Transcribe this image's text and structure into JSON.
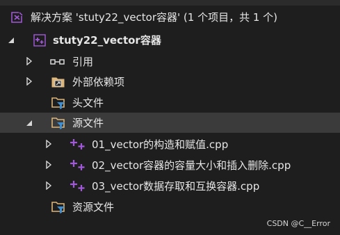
{
  "top_text": "",
  "tree": {
    "solution": {
      "label": "解决方案 'stuty22_vector容器' (1 个项目，共 1 个)",
      "icon": "visual-studio-solution-icon"
    },
    "project": {
      "label": "stuty22_vector容器",
      "icon": "cpp-project-icon"
    },
    "references": {
      "label": "引用",
      "icon": "references-icon"
    },
    "external_deps": {
      "label": "外部依赖项",
      "icon": "external-dependencies-icon"
    },
    "header_files": {
      "label": "头文件",
      "icon": "filter-folder-icon"
    },
    "source_files": {
      "label": "源文件",
      "icon": "filter-folder-icon"
    },
    "files": [
      {
        "label": "01_vector的构造和赋值.cpp",
        "icon": "cpp-file-icon"
      },
      {
        "label": "02_vector容器的容量大小和插入删除.cpp",
        "icon": "cpp-file-icon"
      },
      {
        "label": "03_vector数据存取和互换容器.cpp",
        "icon": "cpp-file-icon"
      }
    ],
    "resource_files": {
      "label": "资源文件",
      "icon": "filter-folder-icon"
    }
  },
  "watermark": "CSDN @C__Error",
  "colors": {
    "background": "#1e1e1e",
    "selected_row": "#3b3b3b",
    "vs_purple": "#a259d9",
    "folder_yellow": "#dcb67a",
    "filter_blue": "#3e8ed0",
    "text": "#e6e6e6"
  }
}
